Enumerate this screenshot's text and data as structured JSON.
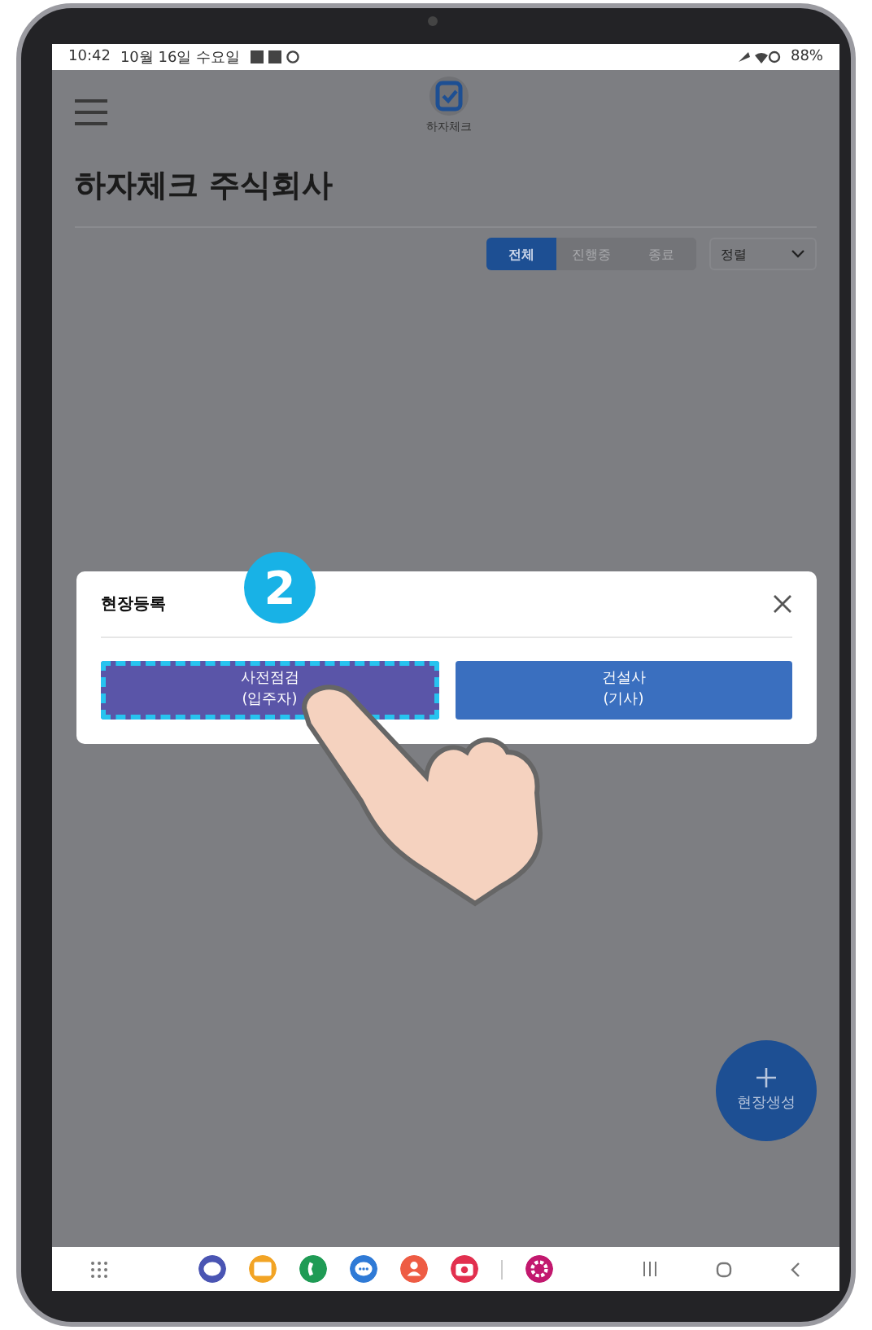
{
  "status_bar": {
    "time": "10:42",
    "date": "10월 16일 수요일",
    "battery": "88%"
  },
  "header": {
    "logo_label": "하자체크"
  },
  "page_title": "하자체크 주식회사",
  "filter_tabs": [
    {
      "label": "전체",
      "selected": true
    },
    {
      "label": "진행중",
      "selected": false
    },
    {
      "label": "종료",
      "selected": false
    }
  ],
  "sort_dropdown": {
    "value": "정렬"
  },
  "dialog": {
    "title": "현장등록",
    "step_badge": "2",
    "buttons": [
      {
        "lines": [
          "사전점검",
          "(입주자)"
        ],
        "highlighted": true,
        "color": "#5a55a8"
      },
      {
        "lines": [
          "건설사",
          "(기사)"
        ],
        "highlighted": false,
        "color": "#3a6fbf"
      }
    ]
  },
  "fab": {
    "label": "현장생성"
  },
  "dock": {
    "apps": [
      {
        "kind": "browser",
        "color": "#4a55b3"
      },
      {
        "kind": "folder",
        "color": "#f2a425"
      },
      {
        "kind": "phone",
        "color": "#1f9b55"
      },
      {
        "kind": "chat",
        "color": "#2f7ad6"
      },
      {
        "kind": "contact",
        "color": "#ee5c44"
      },
      {
        "kind": "camera",
        "color": "#e2304f"
      },
      {
        "kind": "flower",
        "color": "#c2186e"
      }
    ]
  }
}
